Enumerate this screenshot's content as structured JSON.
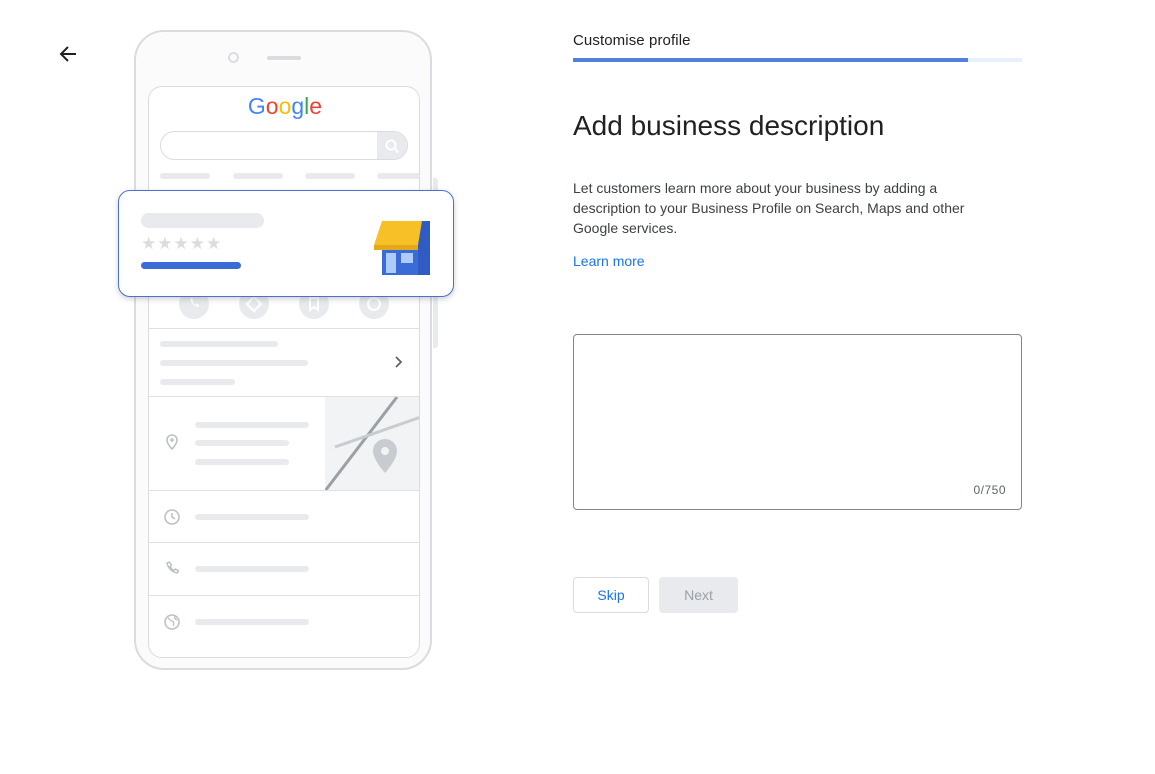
{
  "nav": {
    "back_icon": "arrow-back-icon"
  },
  "illustration": {
    "logo_letters": [
      "G",
      "o",
      "o",
      "g",
      "l",
      "e"
    ],
    "logo_colors": [
      "#4285F4",
      "#EA4335",
      "#FBBC05",
      "#4285F4",
      "#34A853",
      "#EA4335"
    ],
    "stars": "★★★★★",
    "accent_color": "#3b6bd6",
    "icons": [
      "search-icon",
      "phone-icon",
      "directions-icon",
      "bookmark-icon",
      "globe-icon",
      "chevron-right-icon",
      "location-pin-icon",
      "clock-icon",
      "phone-icon",
      "globe-icon",
      "storefront-icon"
    ]
  },
  "step": {
    "label": "Customise profile",
    "progress": 0.88,
    "progress_color": "#4f80e2"
  },
  "main": {
    "heading": "Add business description",
    "description": "Let customers learn more about your business by adding a description to your Business Profile on Search, Maps and other Google services.",
    "learn_more": "Learn more",
    "textarea_value": "",
    "counter": "0/750"
  },
  "buttons": {
    "skip": "Skip",
    "next": "Next"
  }
}
